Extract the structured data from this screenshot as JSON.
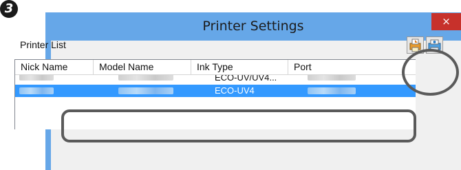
{
  "step": {
    "label": "3"
  },
  "window": {
    "title": "Printer Settings",
    "close_label": "×"
  },
  "printer_list": {
    "label": "Printer List",
    "columns": [
      "Nick Name",
      "Model Name",
      "Ink Type",
      "Port"
    ],
    "rows": [
      {
        "ink_type": "ECO-UV/UV4...",
        "selected": false
      },
      {
        "ink_type": "ECO-UV4",
        "selected": true
      }
    ]
  },
  "toolbar": {
    "add_icon": "add-printer-icon",
    "edit_icon": "printer-settings-icon"
  },
  "colors": {
    "titlebar": "#66a7e8",
    "close": "#c7312b",
    "selection": "#3399ff",
    "highlight_ring": "#5a5a5a"
  }
}
